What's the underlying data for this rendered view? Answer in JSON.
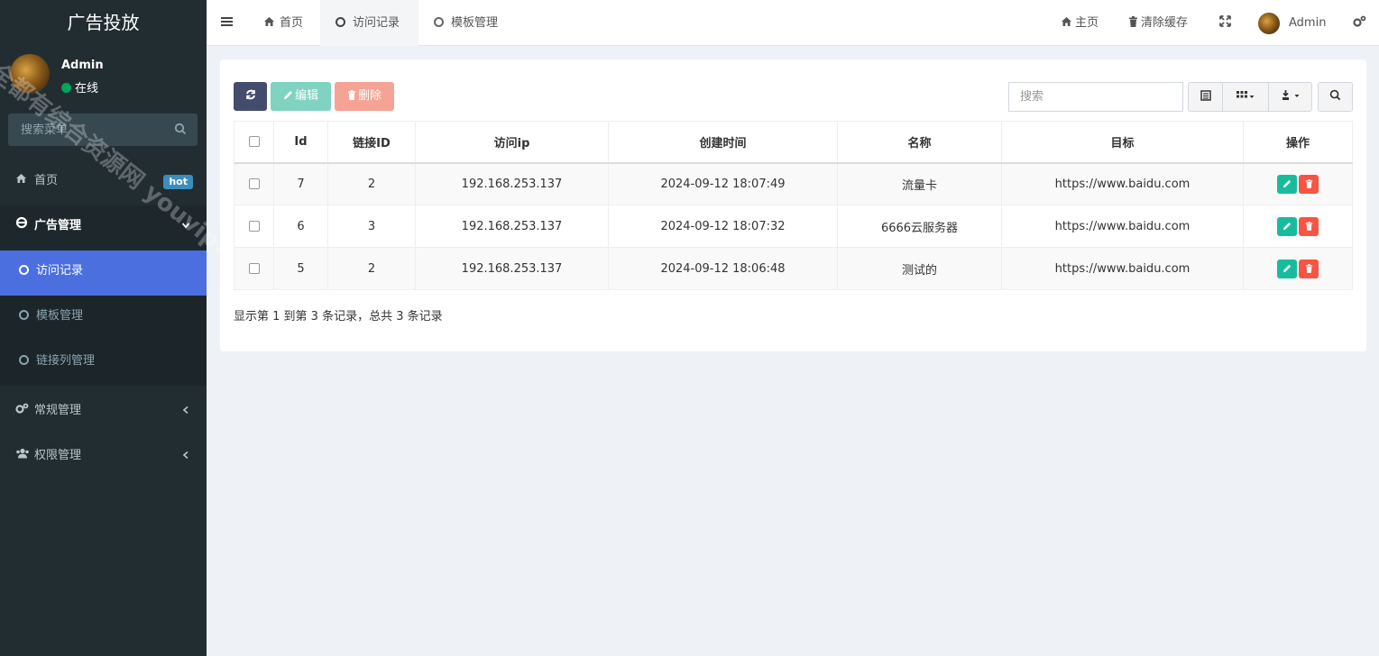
{
  "sidebar": {
    "brand": "广告投放",
    "user": {
      "name": "Admin",
      "status": "在线"
    },
    "search_placeholder": "搜索菜单",
    "menu": {
      "home": {
        "label": "首页",
        "badge": "hot"
      },
      "ads": {
        "label": "广告管理"
      },
      "sub": [
        {
          "label": "访问记录"
        },
        {
          "label": "模板管理"
        },
        {
          "label": "链接列管理"
        }
      ],
      "general": {
        "label": "常规管理"
      },
      "auth": {
        "label": "权限管理"
      }
    },
    "watermark": "全都有综合资源网 youvip.com"
  },
  "topnav": {
    "tabs": [
      {
        "label": "首页"
      },
      {
        "label": "访问记录"
      },
      {
        "label": "模板管理"
      }
    ],
    "right": {
      "home": "主页",
      "clear_cache": "清除缓存",
      "user": "Admin"
    }
  },
  "toolbar": {
    "edit_label": "编辑",
    "delete_label": "删除",
    "search_placeholder": "搜索"
  },
  "table": {
    "headers": [
      "Id",
      "链接ID",
      "访问ip",
      "创建时间",
      "名称",
      "目标",
      "操作"
    ],
    "rows": [
      {
        "id": "7",
        "link_id": "2",
        "ip": "192.168.253.137",
        "created": "2024-09-12 18:07:49",
        "name": "流量卡",
        "target": "https://www.baidu.com"
      },
      {
        "id": "6",
        "link_id": "3",
        "ip": "192.168.253.137",
        "created": "2024-09-12 18:07:32",
        "name": "6666云服务器",
        "target": "https://www.baidu.com"
      },
      {
        "id": "5",
        "link_id": "2",
        "ip": "192.168.253.137",
        "created": "2024-09-12 18:06:48",
        "name": "测试的",
        "target": "https://www.baidu.com"
      }
    ]
  },
  "pagination_info": "显示第 1 到第 3 条记录，总共 3 条记录",
  "colors": {
    "sidebar_bg": "#222d32",
    "active_item": "#4c6fe0",
    "edit_green": "#18bc9c",
    "delete_red": "#f75444",
    "badge_blue": "#3c8dbc"
  }
}
